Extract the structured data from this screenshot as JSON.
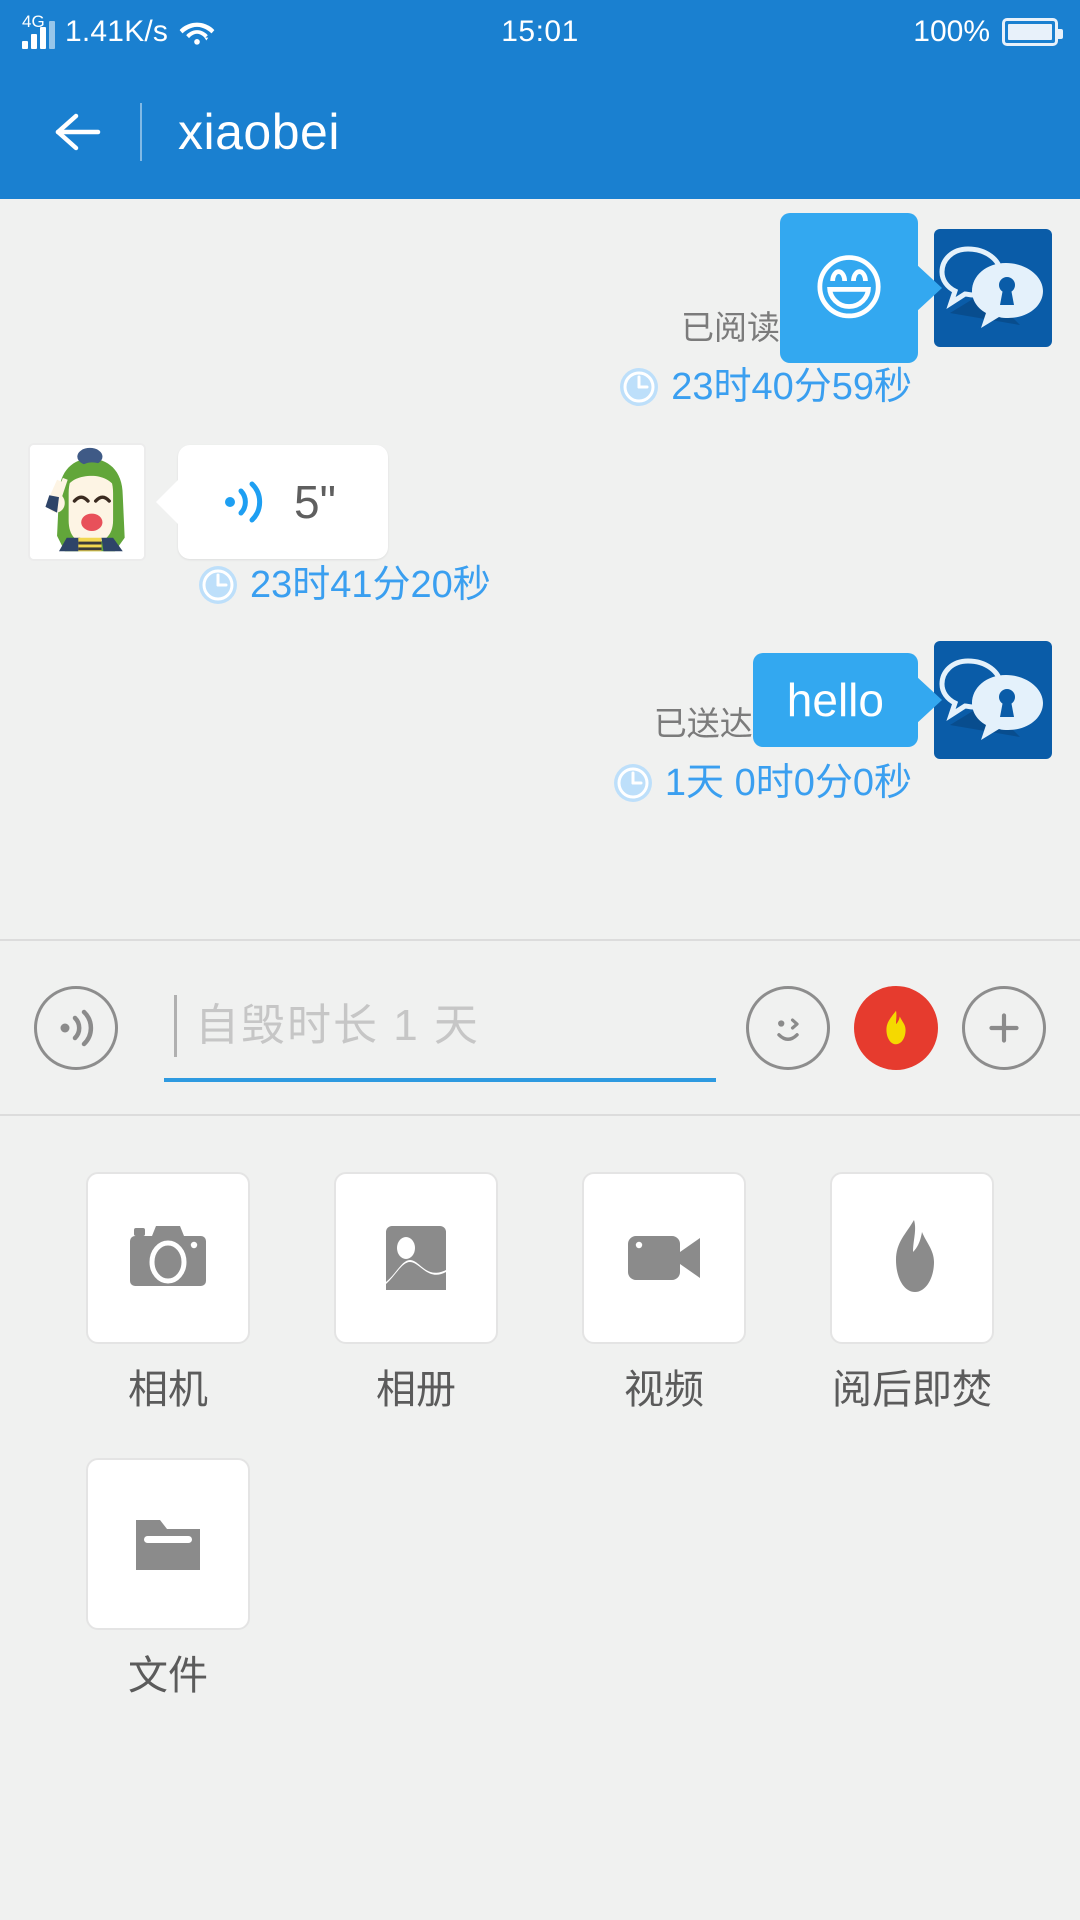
{
  "status_bar": {
    "network_type": "4G",
    "net_speed": "1.41K/s",
    "wifi_icon": "wifi-icon",
    "time": "15:01",
    "battery_percent": "100%",
    "battery_icon": "battery-icon"
  },
  "app_bar": {
    "back_icon": "back-arrow-icon",
    "title": "xiaobei"
  },
  "chat": {
    "messages": [
      {
        "direction": "out",
        "type": "emoji",
        "content": "😄",
        "status_label": "已阅读",
        "timestamp": "23时40分59秒",
        "avatar": "app-logo-avatar"
      },
      {
        "direction": "in",
        "type": "voice",
        "content": "5\"",
        "status_label": "",
        "timestamp": "23时41分20秒",
        "avatar": "anime-girl-avatar"
      },
      {
        "direction": "out",
        "type": "text",
        "content": "hello",
        "status_label": "已送达",
        "timestamp": "1天 0时0分0秒",
        "avatar": "app-logo-avatar"
      }
    ]
  },
  "input_bar": {
    "voice_icon": "voice-record-icon",
    "placeholder": "自毁时长 1 天",
    "value": "",
    "emoji_icon": "emoji-smiley-icon",
    "burn_icon": "flame-burn-icon",
    "plus_icon": "plus-icon"
  },
  "attachments": {
    "items": [
      {
        "label": "相机",
        "icon": "camera-icon"
      },
      {
        "label": "相册",
        "icon": "photo-album-icon"
      },
      {
        "label": "视频",
        "icon": "video-camera-icon"
      },
      {
        "label": "阅后即焚",
        "icon": "flame-icon"
      },
      {
        "label": "文件",
        "icon": "folder-icon"
      }
    ]
  },
  "colors": {
    "brand_blue": "#1a80d0",
    "bubble_blue": "#33a8f0",
    "timestamp_blue": "#3a9ff0",
    "burn_red": "#e63b2e",
    "flame_yellow": "#f5d900",
    "background": "#f0f1f0",
    "icon_gray": "#8b8b8b"
  }
}
